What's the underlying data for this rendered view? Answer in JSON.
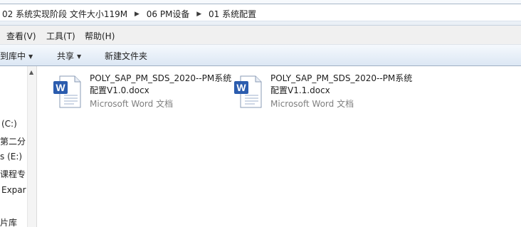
{
  "breadcrumb": {
    "items": [
      "02 系统实现阶段 文件大小119M",
      "06 PM设备",
      "01 系统配置"
    ]
  },
  "menu": {
    "items": [
      "查看(V)",
      "工具(T)",
      "帮助(H)"
    ]
  },
  "toolbar": {
    "include_library": "到库中",
    "share": "共享",
    "new_folder": "新建文件夹"
  },
  "nav": {
    "items": [
      "(C:)",
      "第二分",
      "s (E:)",
      "课程专",
      "Expar",
      "片库"
    ]
  },
  "files": [
    {
      "name": "POLY_SAP_PM_SDS_2020--PM系统配置V1.0.docx",
      "type": "Microsoft Word 文档",
      "icon": "word-document-icon"
    },
    {
      "name": "POLY_SAP_PM_SDS_2020--PM系统配置V1.1.docx",
      "type": "Microsoft Word 文档",
      "icon": "word-document-icon"
    }
  ],
  "colors": {
    "word_blue": "#2b5cae",
    "type_gray": "#7f7f7f",
    "toolbar_gradient_top": "#f5f9fd",
    "toolbar_gradient_bottom": "#dce7f4"
  }
}
